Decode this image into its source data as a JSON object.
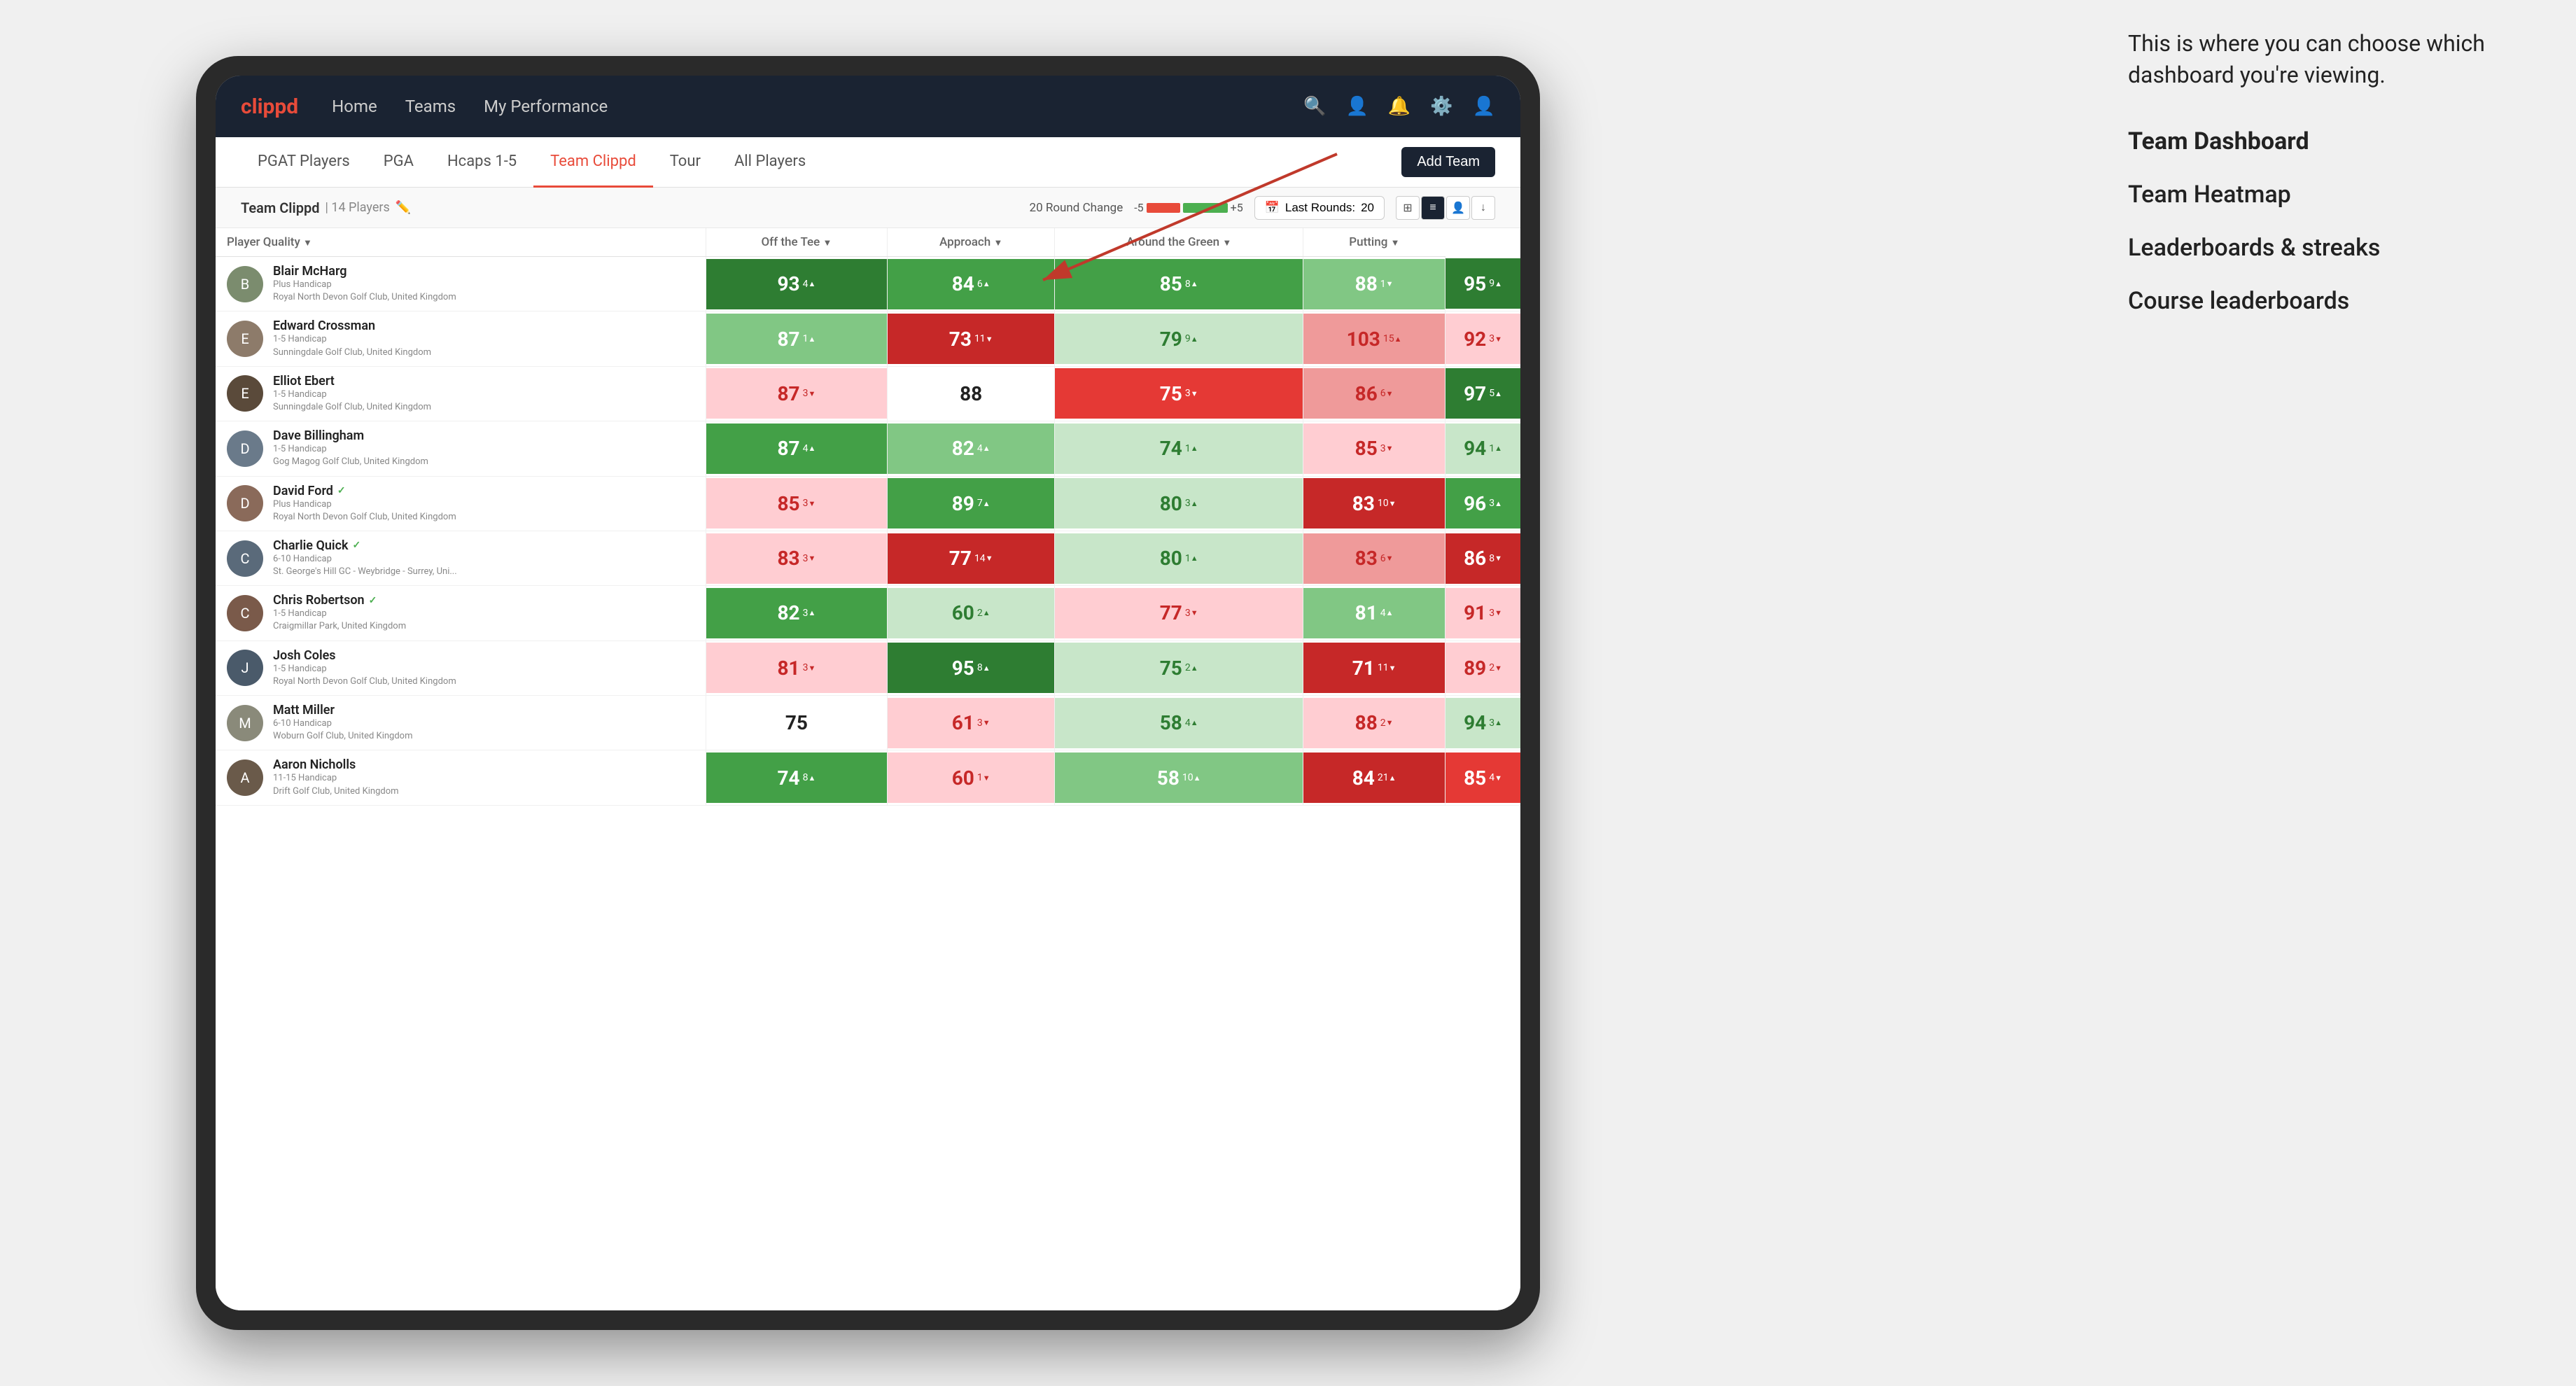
{
  "app": {
    "logo": "clippd",
    "nav_links": [
      "Home",
      "Teams",
      "My Performance"
    ],
    "tab_links": [
      "PGAT Players",
      "PGA",
      "Hcaps 1-5",
      "Team Clippd",
      "Tour",
      "All Players"
    ],
    "active_tab": "Team Clippd",
    "add_team_label": "Add Team"
  },
  "team": {
    "name": "Team Clippd",
    "separator": "|",
    "count": "14 Players",
    "round_change_label": "20 Round Change",
    "neg_value": "-5",
    "pos_value": "+5",
    "last_rounds_label": "Last Rounds:",
    "last_rounds_value": "20"
  },
  "columns": {
    "player": "Player Quality",
    "off_tee": "Off the Tee",
    "approach": "Approach",
    "around_green": "Around the Green",
    "putting": "Putting"
  },
  "players": [
    {
      "name": "Blair McHarg",
      "handicap": "Plus Handicap",
      "club": "Royal North Devon Golf Club, United Kingdom",
      "avatar_color": "#7b8c6e",
      "metrics": {
        "quality": {
          "value": "93",
          "change": "4",
          "dir": "up",
          "color": "green-dark"
        },
        "off_tee": {
          "value": "84",
          "change": "6",
          "dir": "up",
          "color": "green-med"
        },
        "approach": {
          "value": "85",
          "change": "8",
          "dir": "up",
          "color": "green-med"
        },
        "around_green": {
          "value": "88",
          "change": "1",
          "dir": "down",
          "color": "green-light"
        },
        "putting": {
          "value": "95",
          "change": "9",
          "dir": "up",
          "color": "green-dark"
        }
      }
    },
    {
      "name": "Edward Crossman",
      "handicap": "1-5 Handicap",
      "club": "Sunningdale Golf Club, United Kingdom",
      "avatar_color": "#8d7b6a",
      "metrics": {
        "quality": {
          "value": "87",
          "change": "1",
          "dir": "up",
          "color": "green-light"
        },
        "off_tee": {
          "value": "73",
          "change": "11",
          "dir": "down",
          "color": "red-dark"
        },
        "approach": {
          "value": "79",
          "change": "9",
          "dir": "up",
          "color": "green-pale"
        },
        "around_green": {
          "value": "103",
          "change": "15",
          "dir": "up",
          "color": "red-light"
        },
        "putting": {
          "value": "92",
          "change": "3",
          "dir": "down",
          "color": "red-pale"
        }
      }
    },
    {
      "name": "Elliot Ebert",
      "handicap": "1-5 Handicap",
      "club": "Sunningdale Golf Club, United Kingdom",
      "avatar_color": "#5a4a3a",
      "metrics": {
        "quality": {
          "value": "87",
          "change": "3",
          "dir": "down",
          "color": "red-pale"
        },
        "off_tee": {
          "value": "88",
          "change": "",
          "dir": "",
          "color": "white"
        },
        "approach": {
          "value": "75",
          "change": "3",
          "dir": "down",
          "color": "red-med"
        },
        "around_green": {
          "value": "86",
          "change": "6",
          "dir": "down",
          "color": "red-light"
        },
        "putting": {
          "value": "97",
          "change": "5",
          "dir": "up",
          "color": "green-dark"
        }
      }
    },
    {
      "name": "Dave Billingham",
      "handicap": "1-5 Handicap",
      "club": "Gog Magog Golf Club, United Kingdom",
      "avatar_color": "#6a7a8a",
      "metrics": {
        "quality": {
          "value": "87",
          "change": "4",
          "dir": "up",
          "color": "green-med"
        },
        "off_tee": {
          "value": "82",
          "change": "4",
          "dir": "up",
          "color": "green-light"
        },
        "approach": {
          "value": "74",
          "change": "1",
          "dir": "up",
          "color": "green-pale"
        },
        "around_green": {
          "value": "85",
          "change": "3",
          "dir": "down",
          "color": "red-pale"
        },
        "putting": {
          "value": "94",
          "change": "1",
          "dir": "up",
          "color": "green-pale"
        }
      }
    },
    {
      "name": "David Ford",
      "handicap": "Plus Handicap",
      "club": "Royal North Devon Golf Club, United Kingdom",
      "avatar_color": "#8a6a5a",
      "verified": true,
      "metrics": {
        "quality": {
          "value": "85",
          "change": "3",
          "dir": "down",
          "color": "red-pale"
        },
        "off_tee": {
          "value": "89",
          "change": "7",
          "dir": "up",
          "color": "green-med"
        },
        "approach": {
          "value": "80",
          "change": "3",
          "dir": "up",
          "color": "green-pale"
        },
        "around_green": {
          "value": "83",
          "change": "10",
          "dir": "down",
          "color": "red-dark"
        },
        "putting": {
          "value": "96",
          "change": "3",
          "dir": "up",
          "color": "green-med"
        }
      }
    },
    {
      "name": "Charlie Quick",
      "handicap": "6-10 Handicap",
      "club": "St. George's Hill GC - Weybridge - Surrey, Uni...",
      "avatar_color": "#5a6a7a",
      "verified": true,
      "metrics": {
        "quality": {
          "value": "83",
          "change": "3",
          "dir": "down",
          "color": "red-pale"
        },
        "off_tee": {
          "value": "77",
          "change": "14",
          "dir": "down",
          "color": "red-dark"
        },
        "approach": {
          "value": "80",
          "change": "1",
          "dir": "up",
          "color": "green-pale"
        },
        "around_green": {
          "value": "83",
          "change": "6",
          "dir": "down",
          "color": "red-light"
        },
        "putting": {
          "value": "86",
          "change": "8",
          "dir": "down",
          "color": "red-dark"
        }
      }
    },
    {
      "name": "Chris Robertson",
      "handicap": "1-5 Handicap",
      "club": "Craigmillar Park, United Kingdom",
      "avatar_color": "#7a5a4a",
      "verified": true,
      "metrics": {
        "quality": {
          "value": "82",
          "change": "3",
          "dir": "up",
          "color": "green-med"
        },
        "off_tee": {
          "value": "60",
          "change": "2",
          "dir": "up",
          "color": "green-pale"
        },
        "approach": {
          "value": "77",
          "change": "3",
          "dir": "down",
          "color": "red-pale"
        },
        "around_green": {
          "value": "81",
          "change": "4",
          "dir": "up",
          "color": "green-light"
        },
        "putting": {
          "value": "91",
          "change": "3",
          "dir": "down",
          "color": "red-pale"
        }
      }
    },
    {
      "name": "Josh Coles",
      "handicap": "1-5 Handicap",
      "club": "Royal North Devon Golf Club, United Kingdom",
      "avatar_color": "#4a5a6a",
      "metrics": {
        "quality": {
          "value": "81",
          "change": "3",
          "dir": "down",
          "color": "red-pale"
        },
        "off_tee": {
          "value": "95",
          "change": "8",
          "dir": "up",
          "color": "green-dark"
        },
        "approach": {
          "value": "75",
          "change": "2",
          "dir": "up",
          "color": "green-pale"
        },
        "around_green": {
          "value": "71",
          "change": "11",
          "dir": "down",
          "color": "red-dark"
        },
        "putting": {
          "value": "89",
          "change": "2",
          "dir": "down",
          "color": "red-pale"
        }
      }
    },
    {
      "name": "Matt Miller",
      "handicap": "6-10 Handicap",
      "club": "Woburn Golf Club, United Kingdom",
      "avatar_color": "#8a8a7a",
      "metrics": {
        "quality": {
          "value": "75",
          "change": "",
          "dir": "",
          "color": "white"
        },
        "off_tee": {
          "value": "61",
          "change": "3",
          "dir": "down",
          "color": "red-pale"
        },
        "approach": {
          "value": "58",
          "change": "4",
          "dir": "up",
          "color": "green-pale"
        },
        "around_green": {
          "value": "88",
          "change": "2",
          "dir": "down",
          "color": "red-pale"
        },
        "putting": {
          "value": "94",
          "change": "3",
          "dir": "up",
          "color": "green-pale"
        }
      }
    },
    {
      "name": "Aaron Nicholls",
      "handicap": "11-15 Handicap",
      "club": "Drift Golf Club, United Kingdom",
      "avatar_color": "#6a5a4a",
      "metrics": {
        "quality": {
          "value": "74",
          "change": "8",
          "dir": "up",
          "color": "green-med"
        },
        "off_tee": {
          "value": "60",
          "change": "1",
          "dir": "down",
          "color": "red-pale"
        },
        "approach": {
          "value": "58",
          "change": "10",
          "dir": "up",
          "color": "green-light"
        },
        "around_green": {
          "value": "84",
          "change": "21",
          "dir": "up",
          "color": "red-dark"
        },
        "putting": {
          "value": "85",
          "change": "4",
          "dir": "down",
          "color": "red-med"
        }
      }
    }
  ],
  "annotation": {
    "intro": "This is where you can choose which dashboard you're viewing.",
    "items": [
      {
        "label": "Team Dashboard",
        "active": true
      },
      {
        "label": "Team Heatmap",
        "active": false
      },
      {
        "label": "Leaderboards & streaks",
        "active": false
      },
      {
        "label": "Course leaderboards",
        "active": false
      }
    ]
  }
}
